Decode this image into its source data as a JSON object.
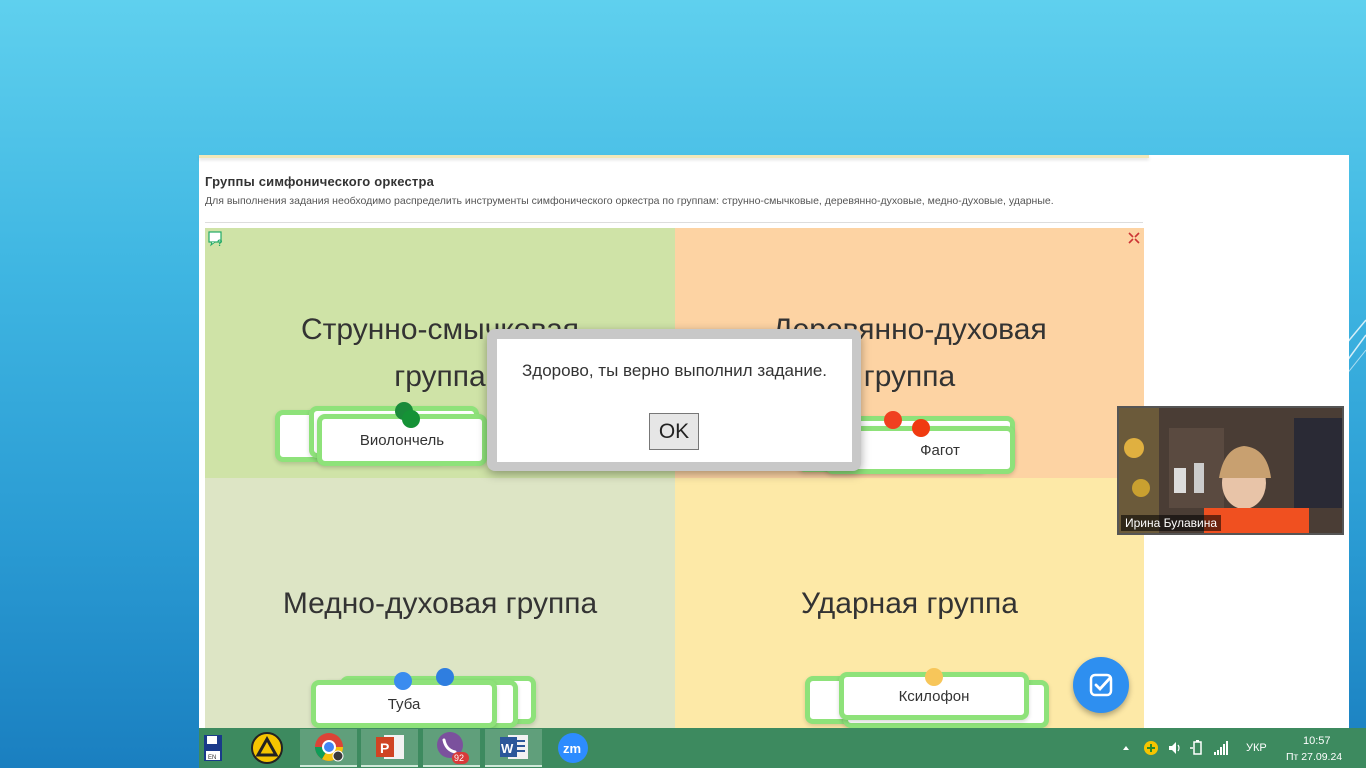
{
  "task": {
    "title": "Группы симфонического оркестра",
    "description": "Для выполнения задания необходимо распределить инструменты симфонического оркестра по группам: струнно-смычковые, деревянно-духовые, медно-духовые, ударные."
  },
  "board": {
    "groups": [
      {
        "title_line1": "Струнно-смычковая",
        "title_line2": "группа"
      },
      {
        "title_line1": "Деревянно-духовая",
        "title_line2": "группа"
      },
      {
        "title": "Медно-духовая группа"
      },
      {
        "title": "Ударная группа"
      }
    ],
    "cards": {
      "strings_top": "Виолончель",
      "woodwind_top": "Фагот",
      "brass_top": "Туба",
      "percussion_top": "Ксилофон"
    }
  },
  "dialog": {
    "message": "Здорово, ты верно выполнил задание.",
    "ok_label": "OK"
  },
  "video": {
    "participant_name": "Ирина Булавина"
  },
  "taskbar": {
    "apps": [
      "floppy-icon",
      "launcher-icon",
      "chrome-icon",
      "powerpoint-icon",
      "viber-icon",
      "word-icon",
      "zoom-icon"
    ],
    "viber_badge": "92",
    "floppy_label": "EN",
    "powerpoint_letter": "P",
    "word_letter": "W",
    "zoom_label": "zm",
    "language": "УКР",
    "time": "10:57",
    "date": "Пт 27.09.24"
  },
  "colors": {
    "strings_area": "#cfe3a7",
    "woodwind_area": "#fdd3a3",
    "brass_area": "#dde5c5",
    "percussion_area": "#fde9a7",
    "card_border": "#8ee27a",
    "check_button": "#2e8ff0",
    "taskbar": "#3d8a5f"
  }
}
